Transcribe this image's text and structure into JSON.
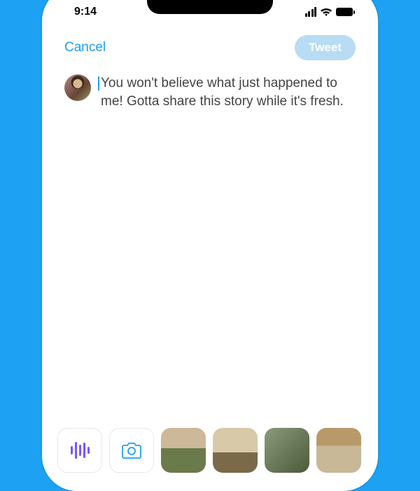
{
  "status": {
    "time": "9:14"
  },
  "header": {
    "cancel_label": "Cancel",
    "tweet_label": "Tweet"
  },
  "compose": {
    "text": "You won't believe what just happened to me! Gotta share this story while it's fresh."
  },
  "colors": {
    "brand": "#1DA1F2",
    "voice": "#7856FF"
  }
}
